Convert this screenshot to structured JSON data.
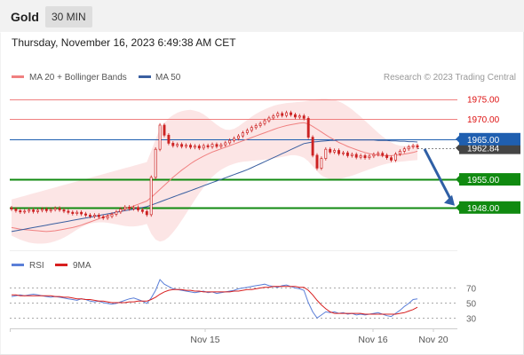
{
  "header": {
    "instrument": "Gold",
    "timeframe": "30 MIN",
    "datetime": "Thursday, November 16, 2023 6:49:38 AM CET"
  },
  "legend": {
    "ma20_label": "MA 20 + Bollinger Bands",
    "ma50_label": "MA 50",
    "credit": "Research © 2023 Trading Central",
    "rsi_label": "RSI",
    "ma9_label": "9MA"
  },
  "colors": {
    "ma20": "#f08080",
    "ma50": "#3a5fa0",
    "bollinger_fill": "#fbe0e0",
    "resistance": "#f08080",
    "resistance_text": "#dd1111",
    "pivot": "#1f5fb0",
    "support": "#108a10",
    "current_price": "#444444",
    "arrow": "#2f5fa5",
    "rsi": "#5b7fd8",
    "rsi_ma": "#d81f1f",
    "candle": "#cc2222"
  },
  "chart_data": [
    {
      "type": "candlestick",
      "instrument": "Gold",
      "timeframe": "30 MIN",
      "x_ticks": [
        "Nov 15",
        "Nov 16",
        "Nov 20"
      ],
      "ylim": [
        1940,
        1978
      ],
      "levels": [
        {
          "value": 1975.0,
          "label": "1975.00",
          "kind": "resistance"
        },
        {
          "value": 1970.0,
          "label": "1970.00",
          "kind": "resistance"
        },
        {
          "value": 1965.0,
          "label": "1965.00",
          "kind": "pivot"
        },
        {
          "value": 1962.84,
          "label": "1962.84",
          "kind": "current"
        },
        {
          "value": 1955.0,
          "label": "1955.00",
          "kind": "support"
        },
        {
          "value": 1948.0,
          "label": "1948.00",
          "kind": "support"
        }
      ],
      "close": [
        1947.6,
        1947.2,
        1946.9,
        1947.1,
        1947.4,
        1947.0,
        1947.3,
        1947.6,
        1947.2,
        1947.5,
        1947.8,
        1947.4,
        1947.1,
        1946.8,
        1946.5,
        1946.8,
        1946.4,
        1946.1,
        1945.8,
        1946.1,
        1945.7,
        1945.4,
        1945.8,
        1946.3,
        1946.9,
        1947.6,
        1948.1,
        1947.7,
        1948.0,
        1947.4,
        1947.0,
        1946.2,
        1955.5,
        1962.5,
        1968.5,
        1966.0,
        1964.0,
        1963.4,
        1963.7,
        1963.2,
        1963.5,
        1963.0,
        1963.3,
        1962.8,
        1963.4,
        1963.1,
        1963.7,
        1963.2,
        1963.6,
        1964.1,
        1964.7,
        1965.2,
        1965.8,
        1966.6,
        1967.2,
        1967.9,
        1968.4,
        1968.9,
        1969.6,
        1970.3,
        1970.8,
        1971.4,
        1970.9,
        1971.6,
        1971.1,
        1970.5,
        1970.8,
        1970.2,
        1965.5,
        1961.0,
        1957.8,
        1960.2,
        1962.5,
        1961.8,
        1962.2,
        1961.4,
        1961.6,
        1960.9,
        1961.2,
        1960.5,
        1960.9,
        1960.4,
        1960.8,
        1961.2,
        1961.5,
        1961.0,
        1960.4,
        1959.8,
        1961.3,
        1962.0,
        1962.6,
        1963.1,
        1963.4,
        1963.0
      ],
      "ma20": [
        1943.0,
        1942.8,
        1942.6,
        1942.5,
        1942.4,
        1942.3,
        1942.2,
        1942.1,
        1942.0,
        1942.1,
        1942.2,
        1942.4,
        1942.6,
        1942.8,
        1943.0,
        1943.3,
        1943.6,
        1944.0,
        1944.4,
        1944.8,
        1945.2,
        1945.6,
        1946.0,
        1946.4,
        1946.8,
        1947.2,
        1947.6,
        1948.0,
        1948.4,
        1948.8,
        1949.2,
        1949.6,
        1950.5,
        1951.5,
        1952.5,
        1953.5,
        1954.5,
        1955.5,
        1956.4,
        1957.3,
        1958.1,
        1958.9,
        1959.6,
        1960.2,
        1960.8,
        1961.3,
        1961.8,
        1962.2,
        1962.6,
        1963.0,
        1963.4,
        1963.8,
        1964.2,
        1964.6,
        1965.0,
        1965.4,
        1965.8,
        1966.2,
        1966.6,
        1967.0,
        1967.4,
        1967.8,
        1968.1,
        1968.4,
        1968.6,
        1968.8,
        1969.0,
        1969.1,
        1968.8,
        1968.2,
        1967.5,
        1966.8,
        1966.1,
        1965.4,
        1964.8,
        1964.2,
        1963.7,
        1963.2,
        1962.8,
        1962.4,
        1962.0,
        1961.7,
        1961.4,
        1961.2,
        1961.0,
        1960.9,
        1960.9,
        1960.9,
        1961.0,
        1961.1,
        1961.3,
        1961.5,
        1961.7,
        1962.0
      ],
      "ma50": [
        1942.0,
        1942.2,
        1942.4,
        1942.6,
        1942.8,
        1943.0,
        1943.2,
        1943.4,
        1943.6,
        1943.8,
        1944.0,
        1944.2,
        1944.4,
        1944.6,
        1944.8,
        1945.0,
        1945.2,
        1945.4,
        1945.6,
        1945.8,
        1946.0,
        1946.2,
        1946.4,
        1946.6,
        1946.8,
        1947.0,
        1947.2,
        1947.4,
        1947.6,
        1947.8,
        1948.0,
        1948.2,
        1948.6,
        1949.0,
        1949.4,
        1949.8,
        1950.2,
        1950.6,
        1951.0,
        1951.4,
        1951.8,
        1952.2,
        1952.6,
        1953.0,
        1953.4,
        1953.8,
        1954.2,
        1954.6,
        1955.0,
        1955.4,
        1955.8,
        1956.2,
        1956.6,
        1957.0,
        1957.4,
        1957.9,
        1958.4,
        1958.9,
        1959.4,
        1959.9,
        1960.4,
        1960.9,
        1961.4,
        1961.9,
        1962.4,
        1962.9,
        1963.4,
        1963.9,
        1964.1,
        1964.3,
        1964.4,
        1964.5,
        1964.6,
        1964.7,
        1964.7,
        1964.8,
        1964.8,
        1964.8,
        1964.8,
        1964.8,
        1964.8,
        1964.8,
        1964.8,
        1964.8,
        1964.7,
        1964.7,
        1964.7,
        1964.6,
        1964.6,
        1964.5,
        1964.5,
        1964.4,
        1964.4,
        1964.3
      ],
      "bb_upper": [
        1950.0,
        1950.3,
        1950.6,
        1950.9,
        1951.2,
        1951.5,
        1951.8,
        1952.1,
        1952.4,
        1952.7,
        1953.0,
        1953.3,
        1953.6,
        1953.9,
        1954.2,
        1954.5,
        1954.8,
        1955.1,
        1955.4,
        1955.7,
        1956.0,
        1956.3,
        1956.6,
        1956.9,
        1957.2,
        1957.5,
        1957.8,
        1958.1,
        1958.4,
        1958.7,
        1959.0,
        1959.3,
        1962.0,
        1965.0,
        1967.5,
        1969.0,
        1970.2,
        1971.0,
        1971.6,
        1972.0,
        1972.2,
        1972.3,
        1972.1,
        1971.8,
        1971.2,
        1970.4,
        1969.5,
        1968.6,
        1967.9,
        1967.4,
        1967.3,
        1967.6,
        1968.2,
        1969.0,
        1969.8,
        1970.6,
        1971.3,
        1971.9,
        1972.4,
        1972.9,
        1973.3,
        1973.6,
        1973.8,
        1974.0,
        1974.1,
        1974.2,
        1974.3,
        1974.4,
        1974.6,
        1974.8,
        1975.0,
        1975.1,
        1975.1,
        1975.0,
        1974.8,
        1974.4,
        1973.9,
        1973.2,
        1972.4,
        1971.5,
        1970.6,
        1969.6,
        1968.6,
        1967.6,
        1966.6,
        1965.7,
        1964.9,
        1964.2,
        1963.7,
        1963.4,
        1963.3,
        1963.4,
        1963.6,
        1963.9
      ],
      "bb_lower": [
        1941.0,
        1940.5,
        1940.0,
        1939.6,
        1939.3,
        1939.1,
        1939.0,
        1939.0,
        1939.1,
        1939.3,
        1939.6,
        1940.0,
        1940.5,
        1941.1,
        1941.8,
        1942.5,
        1943.1,
        1943.6,
        1944.0,
        1944.2,
        1944.3,
        1944.3,
        1944.2,
        1944.0,
        1943.8,
        1943.6,
        1943.4,
        1943.3,
        1943.3,
        1943.4,
        1943.6,
        1943.9,
        1941.5,
        1940.0,
        1939.5,
        1939.8,
        1940.6,
        1941.8,
        1943.2,
        1944.8,
        1946.5,
        1948.2,
        1949.9,
        1951.5,
        1953.0,
        1954.4,
        1955.6,
        1956.6,
        1957.4,
        1958.0,
        1958.5,
        1958.9,
        1959.2,
        1959.4,
        1959.5,
        1959.6,
        1959.7,
        1959.8,
        1959.9,
        1960.0,
        1960.2,
        1960.4,
        1960.6,
        1960.8,
        1961.0,
        1961.0,
        1960.8,
        1960.4,
        1959.5,
        1958.3,
        1957.0,
        1956.0,
        1955.4,
        1955.1,
        1955.0,
        1955.1,
        1955.3,
        1955.6,
        1955.9,
        1956.3,
        1956.7,
        1957.1,
        1957.5,
        1957.9,
        1958.3,
        1958.6,
        1958.9,
        1959.1,
        1959.3,
        1959.4,
        1959.5,
        1959.6,
        1959.7,
        1959.8
      ]
    },
    {
      "type": "line",
      "name": "RSI panel",
      "y_ticks": [
        70,
        50,
        30
      ],
      "rsi": [
        58,
        59,
        60,
        59,
        60,
        61,
        60,
        59,
        58,
        57,
        58,
        57,
        56,
        55,
        54,
        53,
        55,
        54,
        52,
        51,
        52,
        50,
        49,
        48,
        49,
        51,
        53,
        55,
        56,
        54,
        52,
        49,
        56,
        66,
        80,
        74,
        71,
        68,
        67,
        66,
        65,
        64,
        63,
        64,
        65,
        63,
        64,
        62,
        63,
        64,
        65,
        66,
        68,
        69,
        70,
        71,
        72,
        73,
        74,
        72,
        71,
        70,
        72,
        73,
        71,
        69,
        68,
        66,
        50,
        38,
        30,
        34,
        38,
        37,
        38,
        36,
        37,
        35,
        36,
        34,
        35,
        34,
        35,
        36,
        37,
        35,
        33,
        32,
        36,
        40,
        45,
        49,
        54,
        55
      ],
      "rsi_ma": [
        60,
        60,
        59,
        59,
        59,
        59,
        59,
        59,
        59,
        59,
        58,
        58,
        57,
        57,
        56,
        55,
        55,
        54,
        54,
        53,
        52,
        52,
        51,
        50,
        50,
        50,
        50,
        51,
        51,
        52,
        52,
        52,
        54,
        57,
        61,
        64,
        66,
        67,
        67,
        67,
        66,
        66,
        65,
        65,
        64,
        64,
        64,
        64,
        64,
        64,
        64,
        65,
        65,
        66,
        67,
        67,
        68,
        69,
        70,
        70,
        71,
        71,
        71,
        71,
        71,
        71,
        70,
        70,
        66,
        60,
        53,
        47,
        42,
        38,
        36,
        36,
        36,
        36,
        36,
        36,
        36,
        35,
        35,
        35,
        35,
        35,
        35,
        35,
        35,
        36,
        37,
        39,
        41,
        44
      ]
    }
  ]
}
